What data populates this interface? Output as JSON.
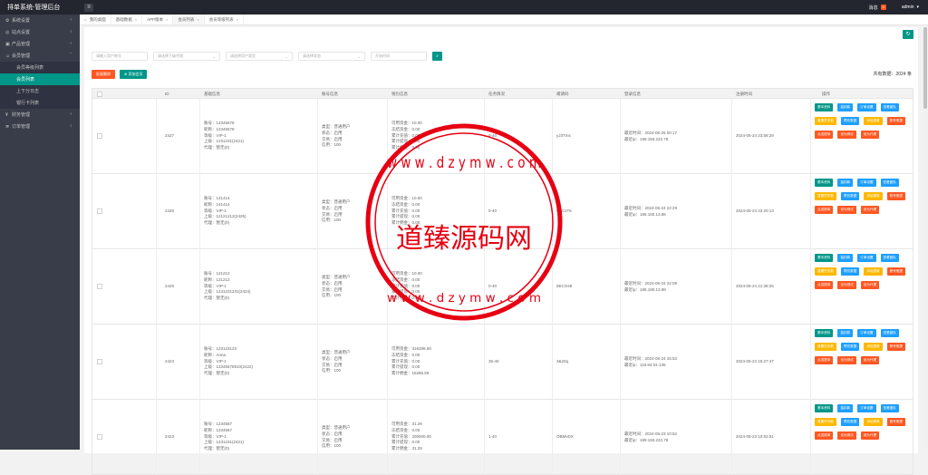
{
  "app": {
    "title": "排单系统-管理后台",
    "menu_icon": "hamburger-icon"
  },
  "topbar": {
    "notify_label": "消息",
    "notify_count": "0",
    "user": "admin"
  },
  "sidebar": {
    "items": [
      {
        "label": "系统设置",
        "icon": "gear-icon"
      },
      {
        "label": "站点设置",
        "icon": "globe-icon"
      },
      {
        "label": "产品管理",
        "icon": "box-icon"
      },
      {
        "label": "会员管理",
        "icon": "user-icon"
      }
    ],
    "sub_items": [
      {
        "label": "会员等级列表"
      },
      {
        "label": "会员列表"
      },
      {
        "label": "上下分日志"
      },
      {
        "label": "银行卡列表"
      }
    ],
    "items_after": [
      {
        "label": "财务管理",
        "icon": "money-icon"
      },
      {
        "label": "订单管理",
        "icon": "order-icon"
      }
    ]
  },
  "tabs": [
    {
      "label": "我的桌面"
    },
    {
      "label": "基础数据"
    },
    {
      "label": "APP版本"
    },
    {
      "label": "会员列表"
    },
    {
      "label": "会员等级列表"
    }
  ],
  "filters": {
    "username_placeholder": "请输入用户账号",
    "agent_placeholder": "请选择下级代理",
    "usertype_placeholder": "请选择用户类型",
    "status_placeholder": "请选择状态",
    "time_placeholder": "开始时间"
  },
  "actions": {
    "batch_delete": "批量删除",
    "add_member": "添加会员"
  },
  "total": {
    "label": "共有数据：",
    "value": "2024",
    "unit": "条"
  },
  "table": {
    "headers": [
      "ID",
      "基础信息",
      "账号信息",
      "钱包信息",
      "任务情况",
      "邀请码",
      "登录信息",
      "注册时间",
      "操作"
    ],
    "op_labels": [
      "基本资料",
      "抽扣款",
      "订单设置",
      "查看团队",
      "重置任务数",
      "帮充数据",
      "添加提款",
      "账号假提",
      "点送提单",
      "设为测试",
      "设为代理"
    ],
    "rows": [
      {
        "id": "2427",
        "basic": [
          "账号：12345678",
          "昵称：12345678",
          "等级：VIP-1",
          "上级：1231231(2421)",
          "代理：暂无(0)"
        ],
        "account": [
          "类型：普通用户",
          "状态：启用",
          "交易：启用",
          "信用：100"
        ],
        "wallet": [
          "可用资金：10.00",
          "冻结资金：0.00",
          "累计充值：0.00",
          "累计提现：0.00",
          "累计佣金：0.00"
        ],
        "task": "0-40",
        "invite": "yJ3Tms",
        "login": [
          "最近时间：2024-05-25 00:17",
          "最近ip：199.150.222.78"
        ],
        "reg": "2024-05-24 23:58:29"
      },
      {
        "id": "2426",
        "basic": [
          "账号：141414",
          "昵称：141414",
          "等级：VIP-1",
          "上级：12121212(2425)",
          "代理：暂无(0)"
        ],
        "account": [
          "类型：普通用户",
          "状态：启用",
          "交易：启用",
          "信用：100"
        ],
        "wallet": [
          "可用资金：10.00",
          "冻结资金：0.00",
          "累计充值：0.00",
          "累计提现：0.00",
          "累计佣金：0.00"
        ],
        "task": "0-40",
        "invite": "wzG1T6",
        "login": [
          "最近时间：2024-05-24 22:29",
          "最近ip：185.180.13.88"
        ],
        "reg": "2024-05-24 22:20:13"
      },
      {
        "id": "2425",
        "basic": [
          "账号：121212",
          "昵称：121212",
          "等级：VIP-1",
          "上级：1231231231(2424)",
          "代理：暂无(0)"
        ],
        "account": [
          "类型：普通用户",
          "状态：启用",
          "交易：启用",
          "信用：100"
        ],
        "wallet": [
          "可用资金：10.00",
          "冻结资金：0.00",
          "累计充值：0.00",
          "累计提现：0.00",
          "累计佣金：0.00"
        ],
        "task": "0-40",
        "invite": "5ECO48",
        "login": [
          "最近时间：2024-05-24 22:09",
          "最近ip：185.180.13.88"
        ],
        "reg": "2024-05-24 21:38:25"
      },
      {
        "id": "2424",
        "basic": [
          "账号：123123123",
          "昵称：Anna",
          "等级：VIP-1",
          "上级：12345678910(2422)",
          "代理：暂无(0)"
        ],
        "account": [
          "类型：普通用户",
          "状态：启用",
          "交易：启用",
          "信用：100"
        ],
        "wallet": [
          "可用资金：316286.59",
          "冻结资金：0.00",
          "累计充值：0.00",
          "累计提现：0.00",
          "累计佣金：16286.59"
        ],
        "task": "35-40",
        "invite": "3&20q",
        "login": [
          "最近时间：2024-05-24 15:53",
          "最近ip：115.84.04.135"
        ],
        "reg": "2024-05-24 15:27:47"
      },
      {
        "id": "2423",
        "basic": [
          "账号：1234567",
          "昵称：1234567",
          "等级：VIP-1",
          "上级：1231231(2421)",
          "代理：暂无(0)"
        ],
        "account": [
          "类型：普通用户",
          "状态：启用",
          "交易：启用",
          "信用：100"
        ],
        "wallet": [
          "可用资金：31.29",
          "冻结资金：0.00",
          "累计充值：200000.00",
          "累计提现：0.00",
          "累计佣金：31.29"
        ],
        "task": "1-40",
        "invite": "OBMvDX",
        "login": [
          "最近时间：2024-05-23 10:52",
          "最近ip：199.150.222.78"
        ],
        "reg": "2024-05-23 10:52:51"
      }
    ]
  },
  "watermark": {
    "text": "道臻源码网",
    "url": "w w w . d z y m w . c o m",
    "color": "#e60012"
  }
}
